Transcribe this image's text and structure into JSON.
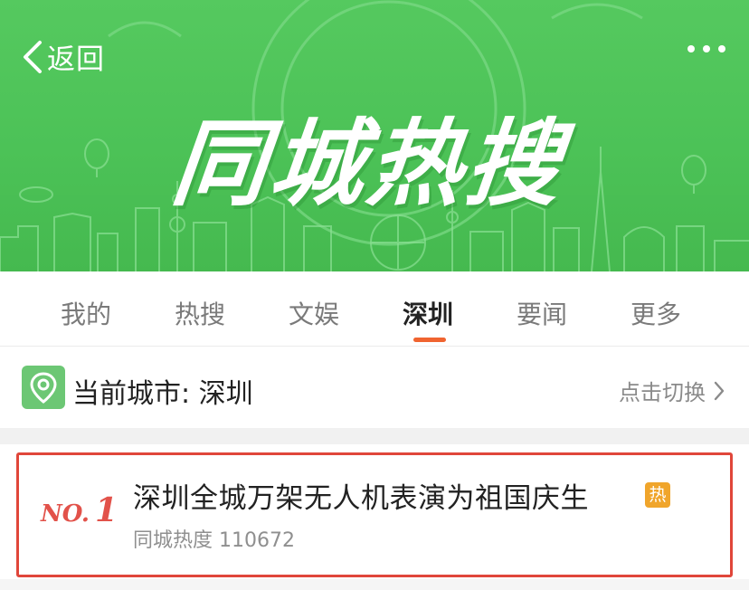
{
  "header": {
    "back_label": "返回",
    "banner_title": "同城热搜",
    "icons": {
      "back": "chevron-left-icon",
      "more": "more-dots-icon"
    }
  },
  "tabs": [
    {
      "label": "我的",
      "active": false
    },
    {
      "label": "热搜",
      "active": false
    },
    {
      "label": "文娱",
      "active": false
    },
    {
      "label": "深圳",
      "active": true
    },
    {
      "label": "要闻",
      "active": false
    },
    {
      "label": "更多",
      "active": false
    }
  ],
  "city": {
    "label": "当前城市: 深圳",
    "switch_label": "点击切换",
    "icons": {
      "location": "location-pin-icon",
      "switch": "chevron-right-icon"
    }
  },
  "hot_list": [
    {
      "rank_prefix": "NO.",
      "rank": "1",
      "title": "深圳全城万架无人机表演为祖国庆生",
      "badge": "热",
      "meta": "同城热度 110672"
    }
  ],
  "colors": {
    "banner_green": "#4cc257",
    "accent_orange": "#f06430",
    "highlight_red": "#e0463a",
    "rank_red": "#e2524a",
    "hot_badge": "#f0a52b"
  }
}
